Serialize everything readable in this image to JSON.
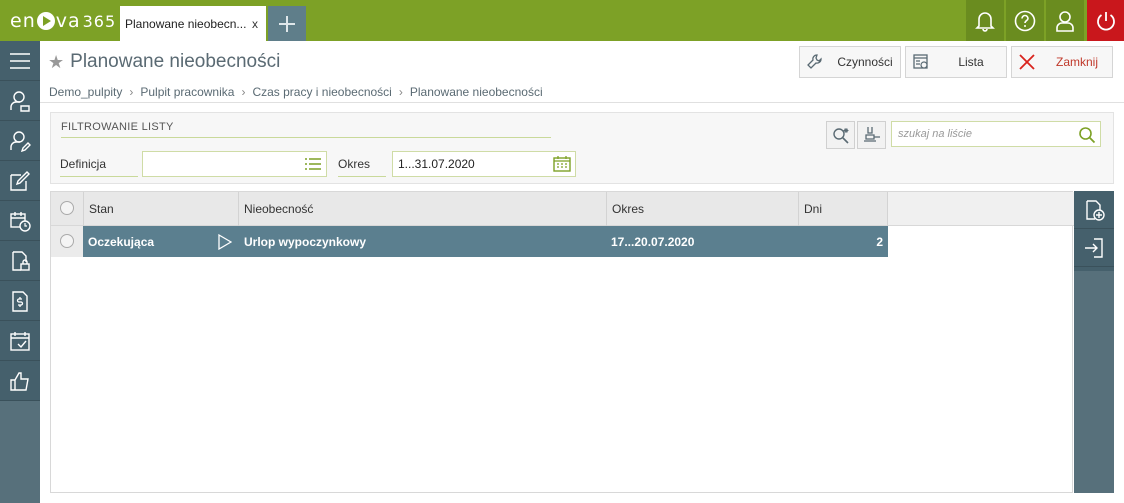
{
  "app": {
    "logo_prefix": "en",
    "logo_suffix": "va",
    "logo_num": "365"
  },
  "tabs": [
    {
      "label": "Planowane nieobecn...",
      "close": "x"
    }
  ],
  "topbar_icons": [
    "bell-icon",
    "help-icon",
    "user-icon",
    "power-icon"
  ],
  "sidebar": {
    "icons": [
      "menu-icon",
      "employee-icon",
      "employee-edit-icon",
      "edit-icon",
      "calendar-clock-icon",
      "lock-document-icon",
      "money-document-icon",
      "calendar-check-icon",
      "thumbs-up-icon"
    ]
  },
  "page": {
    "title": "Planowane nieobecności"
  },
  "actions": {
    "czynnosci": "Czynności",
    "lista": "Lista",
    "zamknij": "Zamknij"
  },
  "breadcrumb": [
    "Demo_pulpity",
    "Pulpit pracownika",
    "Czas pracy i nieobecności",
    "Planowane nieobecności"
  ],
  "filter": {
    "header": "FILTROWANIE LISTY",
    "definicja_label": "Definicja",
    "definicja_value": "",
    "okres_label": "Okres",
    "okres_value": "1...31.07.2020",
    "search_placeholder": "szukaj na liście"
  },
  "grid": {
    "columns": [
      "Stan",
      "Nieobecność",
      "Okres",
      "Dni"
    ],
    "rows": [
      {
        "stan": "Oczekująca",
        "nieobecnosc": "Urlop wypoczynkowy",
        "okres": "17...20.07.2020",
        "dni": "2"
      }
    ]
  },
  "colors": {
    "accent": "#7da126",
    "sidebar": "#45606c",
    "row_selected": "#5b7f8f",
    "close": "#c9171c"
  }
}
